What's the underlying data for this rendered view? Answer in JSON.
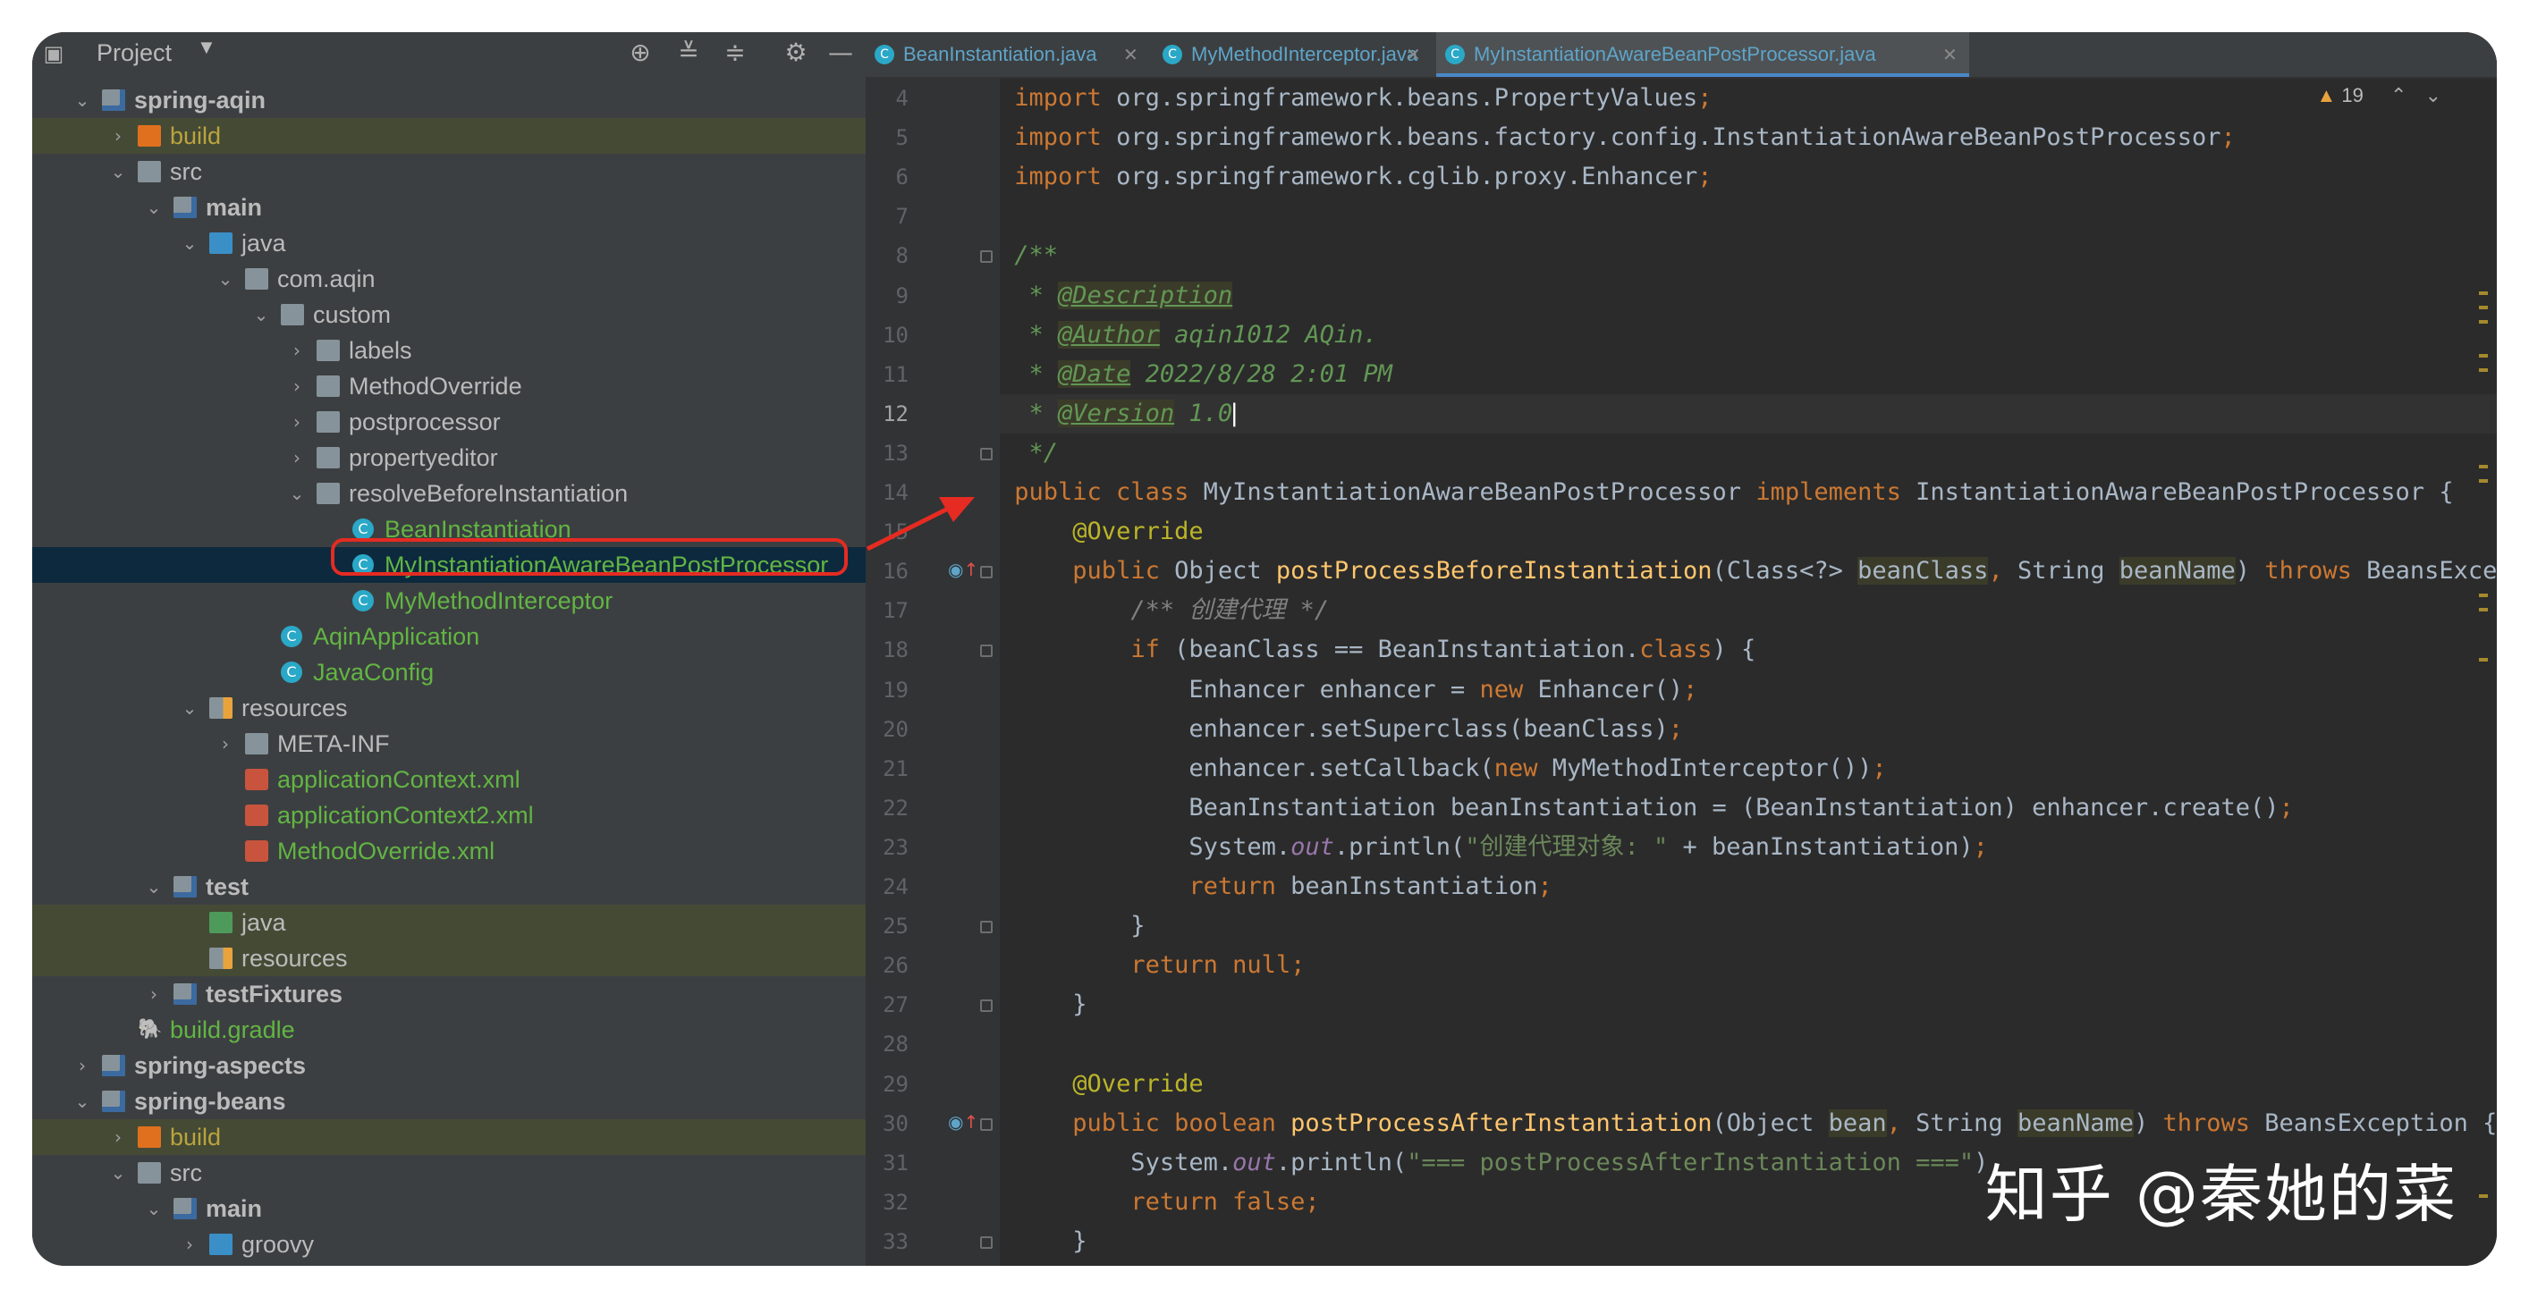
{
  "project_panel": {
    "title": "Project",
    "toolbar_icons": [
      "locate-icon",
      "collapse-all-icon",
      "expand-all-icon",
      "gear-icon",
      "minimize-icon"
    ]
  },
  "tree": [
    {
      "label": "spring-aqin",
      "depth": 0,
      "arrow": "down",
      "icon": "module-folder",
      "bold": true
    },
    {
      "label": "build",
      "depth": 1,
      "arrow": "right",
      "icon": "build-folder",
      "color": "olive",
      "hl": true
    },
    {
      "label": "src",
      "depth": 1,
      "arrow": "down",
      "icon": "folder"
    },
    {
      "label": "main",
      "depth": 2,
      "arrow": "down",
      "icon": "module-folder",
      "bold": true
    },
    {
      "label": "java",
      "depth": 3,
      "arrow": "down",
      "icon": "source-folder"
    },
    {
      "label": "com.aqin",
      "depth": 4,
      "arrow": "down",
      "icon": "package"
    },
    {
      "label": "custom",
      "depth": 5,
      "arrow": "down",
      "icon": "package"
    },
    {
      "label": "labels",
      "depth": 6,
      "arrow": "right",
      "icon": "package"
    },
    {
      "label": "MethodOverride",
      "depth": 6,
      "arrow": "right",
      "icon": "package"
    },
    {
      "label": "postprocessor",
      "depth": 6,
      "arrow": "right",
      "icon": "package"
    },
    {
      "label": "propertyeditor",
      "depth": 6,
      "arrow": "right",
      "icon": "package"
    },
    {
      "label": "resolveBeforeInstantiation",
      "depth": 6,
      "arrow": "down",
      "icon": "package"
    },
    {
      "label": "BeanInstantiation",
      "depth": 7,
      "arrow": "",
      "icon": "class",
      "color": "green"
    },
    {
      "label": "MyInstantiationAwareBeanPostProcessor",
      "depth": 7,
      "arrow": "",
      "icon": "class",
      "color": "green",
      "sel": true
    },
    {
      "label": "MyMethodInterceptor",
      "depth": 7,
      "arrow": "",
      "icon": "class",
      "color": "green"
    },
    {
      "label": "AqinApplication",
      "depth": 5,
      "arrow": "",
      "icon": "class",
      "color": "green"
    },
    {
      "label": "JavaConfig",
      "depth": 5,
      "arrow": "",
      "icon": "class",
      "color": "green"
    },
    {
      "label": "resources",
      "depth": 3,
      "arrow": "down",
      "icon": "resources-folder"
    },
    {
      "label": "META-INF",
      "depth": 4,
      "arrow": "right",
      "icon": "folder"
    },
    {
      "label": "applicationContext.xml",
      "depth": 4,
      "arrow": "",
      "icon": "xml",
      "color": "green"
    },
    {
      "label": "applicationContext2.xml",
      "depth": 4,
      "arrow": "",
      "icon": "xml",
      "color": "green"
    },
    {
      "label": "MethodOverride.xml",
      "depth": 4,
      "arrow": "",
      "icon": "xml",
      "color": "green"
    },
    {
      "label": "test",
      "depth": 2,
      "arrow": "down",
      "icon": "module-folder",
      "bold": true
    },
    {
      "label": "java",
      "depth": 3,
      "arrow": "",
      "icon": "test-folder",
      "hl": true
    },
    {
      "label": "resources",
      "depth": 3,
      "arrow": "",
      "icon": "resources-folder",
      "hl": true
    },
    {
      "label": "testFixtures",
      "depth": 2,
      "arrow": "right",
      "icon": "module-folder",
      "bold": true
    },
    {
      "label": "build.gradle",
      "depth": 1,
      "arrow": "",
      "icon": "gradle",
      "color": "green"
    },
    {
      "label": "spring-aspects",
      "depth": 0,
      "arrow": "right",
      "icon": "module-folder",
      "bold": true
    },
    {
      "label": "spring-beans",
      "depth": 0,
      "arrow": "down",
      "icon": "module-folder",
      "bold": true
    },
    {
      "label": "build",
      "depth": 1,
      "arrow": "right",
      "icon": "build-folder",
      "color": "olive",
      "hl": true
    },
    {
      "label": "src",
      "depth": 1,
      "arrow": "down",
      "icon": "folder"
    },
    {
      "label": "main",
      "depth": 2,
      "arrow": "down",
      "icon": "module-folder",
      "bold": true
    },
    {
      "label": "groovy",
      "depth": 3,
      "arrow": "right",
      "icon": "source-folder"
    }
  ],
  "tabs": [
    {
      "label": "BeanInstantiation.java",
      "active": false
    },
    {
      "label": "MyMethodInterceptor.java",
      "active": false
    },
    {
      "label": "MyInstantiationAwareBeanPostProcessor.java",
      "active": true
    }
  ],
  "inspections": {
    "count": "19",
    "icon": "warning-icon"
  },
  "code": [
    {
      "n": "4",
      "t": [
        [
          "kw",
          "import "
        ],
        [
          "",
          "org.springframework.beans.PropertyValues"
        ],
        [
          "kw",
          ";"
        ]
      ]
    },
    {
      "n": "5",
      "t": [
        [
          "kw",
          "import "
        ],
        [
          "",
          "org.springframework.beans.factory.config.InstantiationAwareBeanPostProcessor"
        ],
        [
          "kw",
          ";"
        ]
      ]
    },
    {
      "n": "6",
      "t": [
        [
          "kw",
          "import "
        ],
        [
          "",
          "org.springframework.cglib.proxy.Enhancer"
        ],
        [
          "kw",
          ";"
        ]
      ]
    },
    {
      "n": "7",
      "t": []
    },
    {
      "n": "8",
      "t": [
        [
          "dc",
          "/**"
        ]
      ],
      "fold": true
    },
    {
      "n": "9",
      "t": [
        [
          "dc",
          " * "
        ],
        [
          "dt",
          "@Description"
        ]
      ]
    },
    {
      "n": "10",
      "t": [
        [
          "dc",
          " * "
        ],
        [
          "dt",
          "@Author"
        ],
        [
          "dc",
          " aqin1012 AQin."
        ]
      ]
    },
    {
      "n": "11",
      "t": [
        [
          "dc",
          " * "
        ],
        [
          "dt",
          "@Date"
        ],
        [
          "dc",
          " 2022/8/28 2:01 PM"
        ]
      ]
    },
    {
      "n": "12",
      "t": [
        [
          "dc",
          " * "
        ],
        [
          "dt",
          "@Version"
        ],
        [
          "dc",
          " 1.0"
        ]
      ],
      "cur": true
    },
    {
      "n": "13",
      "t": [
        [
          "dc",
          " */"
        ]
      ],
      "fold": true
    },
    {
      "n": "14",
      "t": [
        [
          "kw",
          "public class "
        ],
        [
          "",
          "MyInstantiationAwareBeanPostProcessor "
        ],
        [
          "kw",
          "implements "
        ],
        [
          "",
          "InstantiationAwareBeanPostProcessor {"
        ]
      ]
    },
    {
      "n": "15",
      "t": [
        [
          "",
          "    "
        ],
        [
          "an",
          "@Override"
        ]
      ]
    },
    {
      "n": "16",
      "t": [
        [
          "",
          "    "
        ],
        [
          "kw",
          "public "
        ],
        [
          "",
          "Object "
        ],
        [
          "fn",
          "postProcessBeforeInstantiation"
        ],
        [
          "",
          "(Class<?> "
        ],
        [
          "pm",
          "beanClass"
        ],
        [
          "kw",
          ", "
        ],
        [
          "",
          "String "
        ],
        [
          "pm",
          "beanName"
        ],
        [
          "",
          ") "
        ],
        [
          "kw",
          "throws "
        ],
        [
          "",
          "BeansException {"
        ]
      ],
      "fold": true,
      "mark": true
    },
    {
      "n": "17",
      "t": [
        [
          "",
          "        "
        ],
        [
          "cm",
          "/** "
        ],
        [
          "cm",
          "创建代理 */"
        ]
      ]
    },
    {
      "n": "18",
      "t": [
        [
          "",
          "        "
        ],
        [
          "kw",
          "if "
        ],
        [
          "",
          "(beanClass == BeanInstantiation."
        ],
        [
          "kw",
          "class"
        ],
        [
          "",
          ") {"
        ]
      ],
      "fold": true
    },
    {
      "n": "19",
      "t": [
        [
          "",
          "            Enhancer enhancer = "
        ],
        [
          "kw",
          "new "
        ],
        [
          "",
          "Enhancer()"
        ],
        [
          "kw",
          ";"
        ]
      ]
    },
    {
      "n": "20",
      "t": [
        [
          "",
          "            enhancer.setSuperclass(beanClass)"
        ],
        [
          "kw",
          ";"
        ]
      ]
    },
    {
      "n": "21",
      "t": [
        [
          "",
          "            enhancer.setCallback("
        ],
        [
          "kw",
          "new "
        ],
        [
          "",
          "MyMethodInterceptor())"
        ],
        [
          "kw",
          ";"
        ]
      ]
    },
    {
      "n": "22",
      "t": [
        [
          "",
          "            BeanInstantiation beanInstantiation = (BeanInstantiation) enhancer.create()"
        ],
        [
          "kw",
          ";"
        ]
      ]
    },
    {
      "n": "23",
      "t": [
        [
          "",
          "            System."
        ],
        [
          "sf",
          "out"
        ],
        [
          "",
          ".println("
        ],
        [
          "st",
          "\"创建代理对象: \" "
        ],
        [
          "",
          "+ beanInstantiation)"
        ],
        [
          "kw",
          ";"
        ]
      ]
    },
    {
      "n": "24",
      "t": [
        [
          "",
          "            "
        ],
        [
          "kw",
          "return "
        ],
        [
          "",
          "beanInstantiation"
        ],
        [
          "kw",
          ";"
        ]
      ]
    },
    {
      "n": "25",
      "t": [
        [
          "",
          "        }"
        ]
      ],
      "fold": true
    },
    {
      "n": "26",
      "t": [
        [
          "",
          "        "
        ],
        [
          "kw",
          "return null;"
        ]
      ]
    },
    {
      "n": "27",
      "t": [
        [
          "",
          "    }"
        ]
      ],
      "fold": true
    },
    {
      "n": "28",
      "t": []
    },
    {
      "n": "29",
      "t": [
        [
          "",
          "    "
        ],
        [
          "an",
          "@Override"
        ]
      ]
    },
    {
      "n": "30",
      "t": [
        [
          "",
          "    "
        ],
        [
          "kw",
          "public boolean "
        ],
        [
          "fn",
          "postProcessAfterInstantiation"
        ],
        [
          "",
          "(Object "
        ],
        [
          "pm",
          "bean"
        ],
        [
          "kw",
          ", "
        ],
        [
          "",
          "String "
        ],
        [
          "pm",
          "beanName"
        ],
        [
          "",
          ") "
        ],
        [
          "kw",
          "throws "
        ],
        [
          "",
          "BeansException {"
        ]
      ],
      "fold": true,
      "mark": true
    },
    {
      "n": "31",
      "t": [
        [
          "",
          "        System."
        ],
        [
          "sf",
          "out"
        ],
        [
          "",
          ".println("
        ],
        [
          "st",
          "\"=== postProcessAfterInstantiation ===\""
        ],
        [
          "",
          ")"
        ]
      ]
    },
    {
      "n": "32",
      "t": [
        [
          "",
          "        "
        ],
        [
          "kw",
          "return false;"
        ]
      ]
    },
    {
      "n": "33",
      "t": [
        [
          "",
          "    }"
        ]
      ],
      "fold": true
    }
  ],
  "watermark": "知乎 @秦她的菜",
  "colors": {
    "annotation": "#e52b22",
    "keyword": "#cc7832",
    "string": "#6a8759",
    "method": "#ffc66d",
    "doc": "#629755"
  }
}
